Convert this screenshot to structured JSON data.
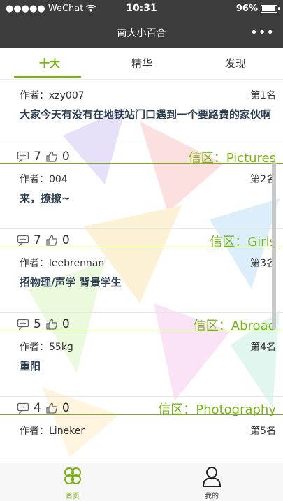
{
  "status_bar": {
    "carrier": "●●●●● WeChat",
    "time": "10:31",
    "battery": "96%",
    "battery_level": 0.96
  },
  "nav": {
    "title": "南大小百合",
    "more": "•••"
  },
  "tabs": [
    {
      "label": "十大",
      "active": true
    },
    {
      "label": "精华",
      "active": false
    },
    {
      "label": "发现",
      "active": false
    }
  ],
  "posts": [
    {
      "author": "作者：xzy007",
      "rank": "第1名",
      "title": "大家今天有没有在地铁站门口遇到一个要路费的家伙啊",
      "comments": "7",
      "likes": "0",
      "forum": "信区：Pictures"
    },
    {
      "author": "作者：004",
      "rank": "第2名",
      "title": "来，撩撩~",
      "comments": "7",
      "likes": "0",
      "forum": "信区：Girls"
    },
    {
      "author": "作者：leebrennan",
      "rank": "第3名",
      "title": "招物理/声学 背景学生",
      "comments": "5",
      "likes": "0",
      "forum": "信区：Abroad"
    },
    {
      "author": "作者：55kg",
      "rank": "第4名",
      "title": "重阳",
      "comments": "4",
      "likes": "0",
      "forum": "信区：Photography"
    },
    {
      "author": "作者：Lineker",
      "rank": "第5名",
      "title": "",
      "comments": "",
      "likes": "",
      "forum": ""
    }
  ],
  "bottom_bar": {
    "home_label": "首页",
    "mine_label": "我的"
  },
  "colors": {
    "accent": "#7ab317",
    "bar": "#3c3c3c"
  }
}
